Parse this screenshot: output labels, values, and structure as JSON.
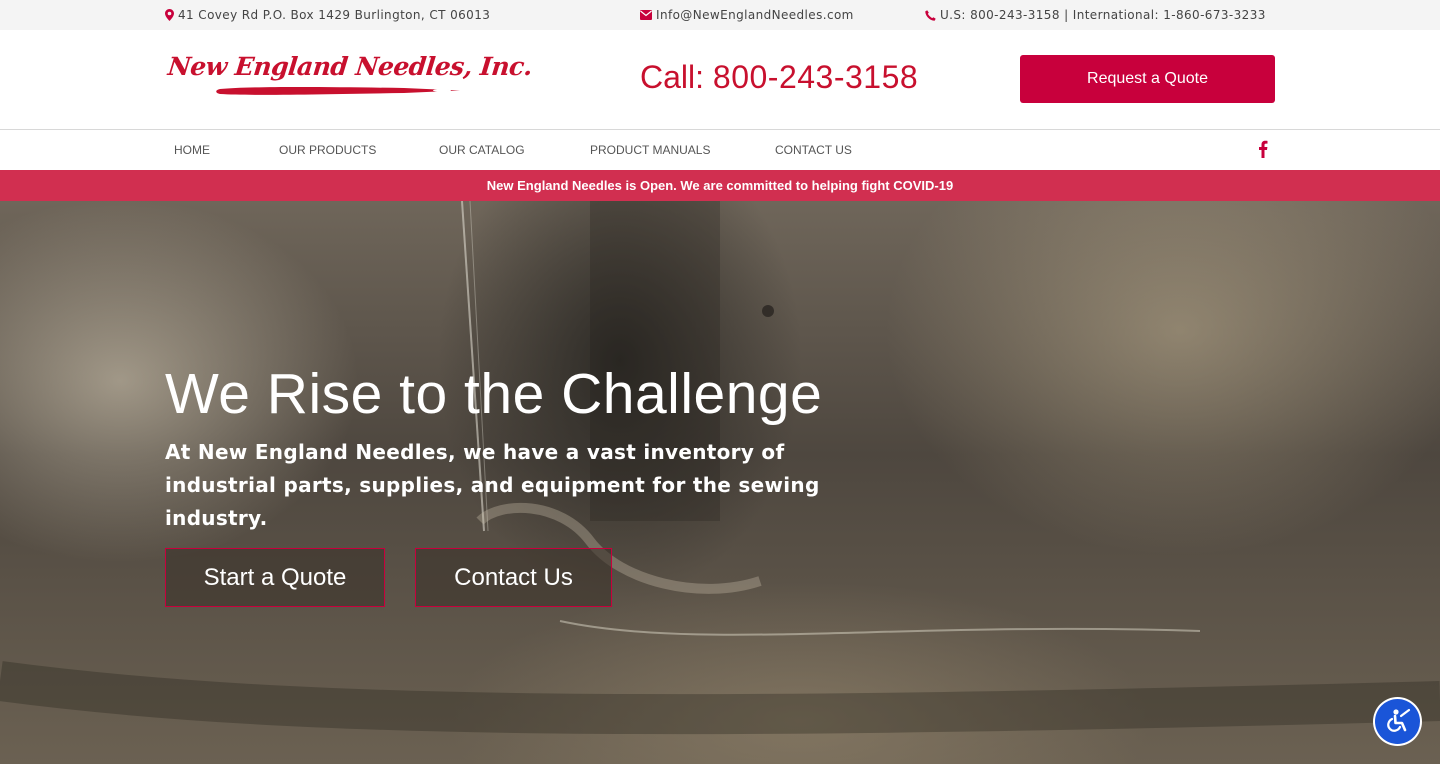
{
  "topbar": {
    "address": "41 Covey Rd P.O. Box 1429 Burlington, CT 06013",
    "email": "Info@NewEnglandNeedles.com",
    "phone": "U.S: 800-243-3158 | International: 1-860-673-3233",
    "icons": [
      "map-marker-icon",
      "envelope-icon",
      "phone-icon"
    ]
  },
  "header": {
    "logo_text": "New England Needles, Inc.",
    "call_label": "Call:",
    "call_number": "800-243-3158",
    "quote_button": "Request a Quote"
  },
  "nav": {
    "items": [
      {
        "label": "HOME"
      },
      {
        "label": "OUR PRODUCTS"
      },
      {
        "label": "OUR CATALOG"
      },
      {
        "label": "PRODUCT MANUALS"
      },
      {
        "label": "CONTACT US"
      }
    ],
    "social_icon": "facebook-icon"
  },
  "banner": {
    "text": "New England Needles is Open. We are committed to helping fight COVID-19"
  },
  "hero": {
    "title": "We Rise to the Challenge",
    "subtitle": "At New England Needles, we have a vast inventory of industrial parts, supplies, and equipment for the sewing industry.",
    "buttons": {
      "start": "Start a Quote",
      "contact": "Contact Us"
    }
  },
  "accessibility": {
    "icon": "accessibility-icon"
  },
  "colors": {
    "brand": "#c8003c",
    "banner": "#d12f50",
    "accessibility": "#1a55d8"
  }
}
